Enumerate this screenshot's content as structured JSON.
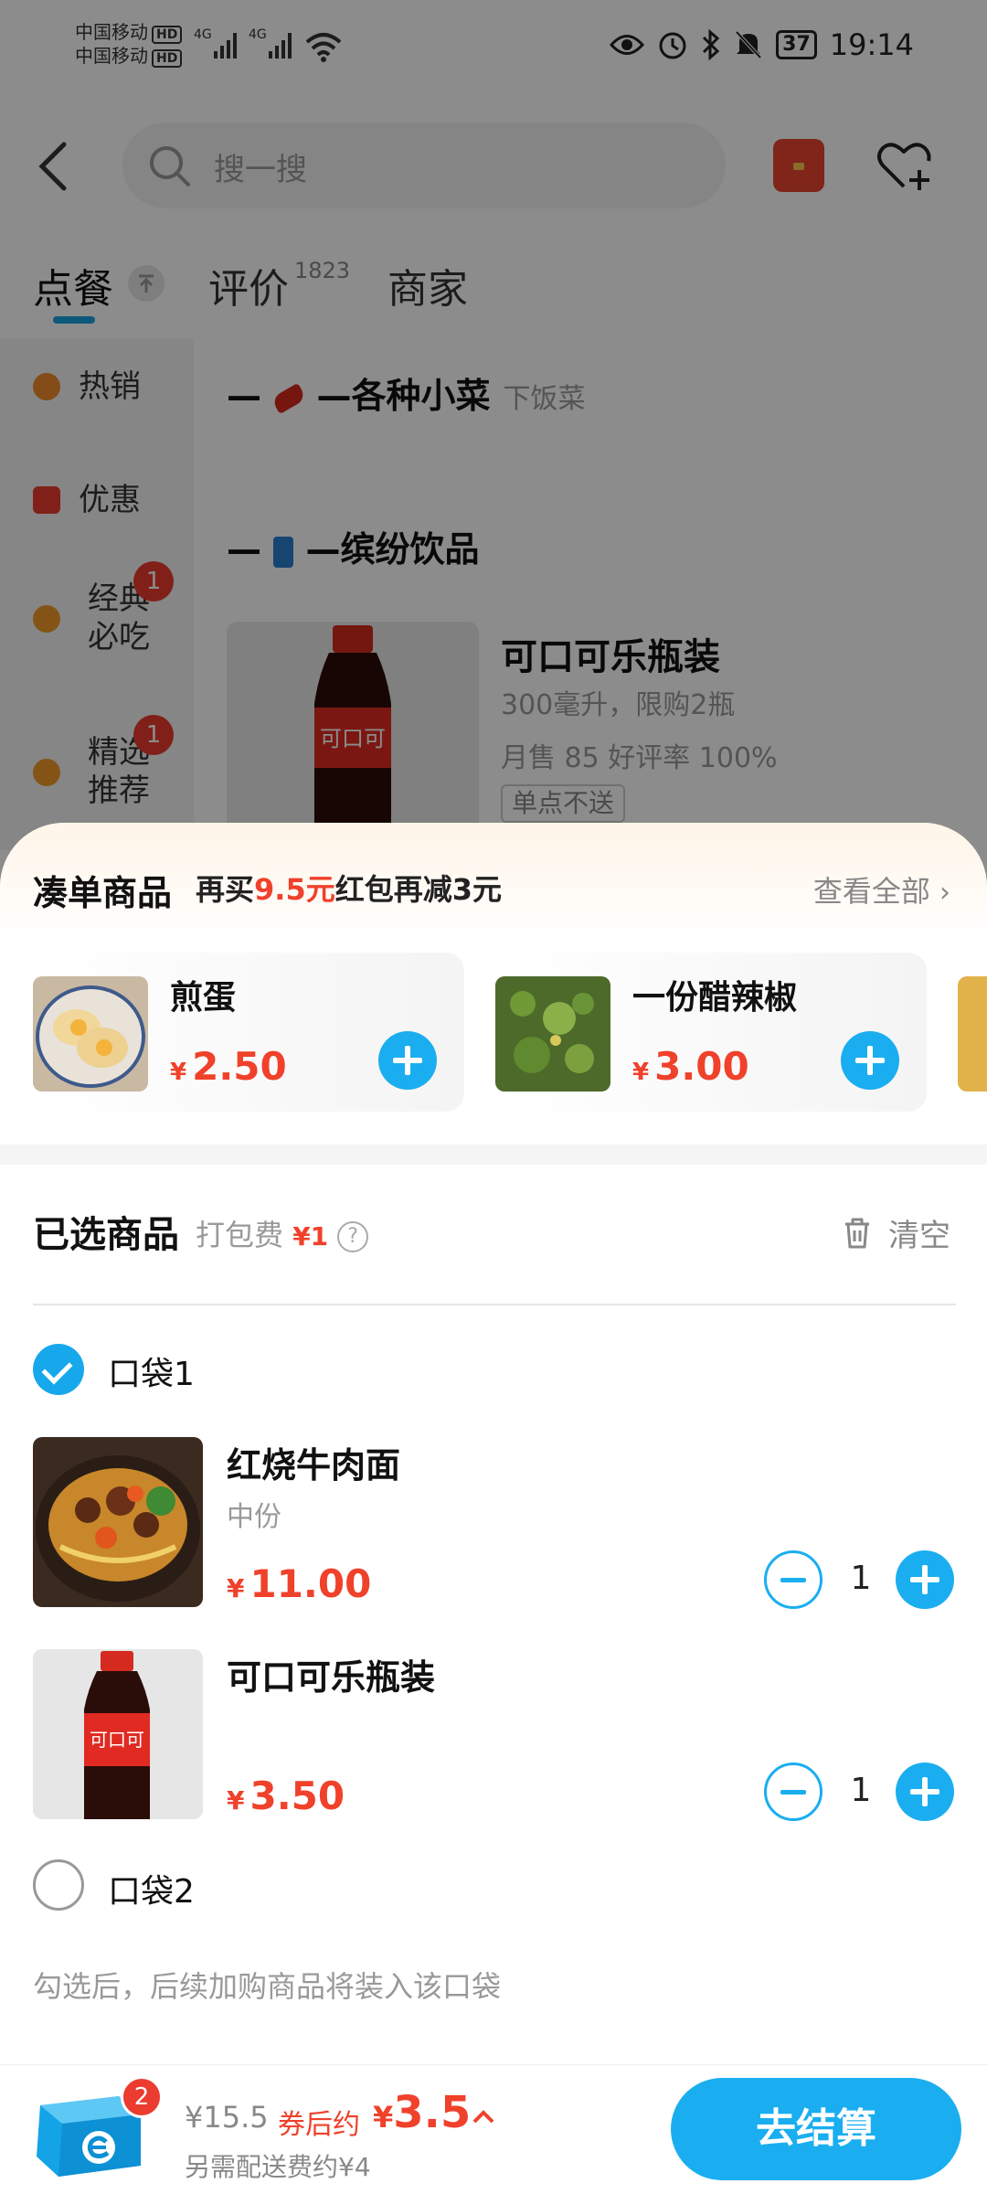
{
  "status_bar": {
    "carrier1": "中国移动",
    "carrier2": "中国移动",
    "hd": "HD",
    "net1": "4G",
    "net2": "4G",
    "battery": "37",
    "time": "19:14"
  },
  "header": {
    "search_placeholder": "搜一搜"
  },
  "tabs": {
    "order": "点餐",
    "reviews": "评价",
    "reviews_count": "1823",
    "merchant": "商家"
  },
  "sidebar": {
    "items": [
      {
        "label": "热销"
      },
      {
        "label": "优惠"
      },
      {
        "label": "经典必吃",
        "line1": "经典",
        "line2": "必吃",
        "badge": "1"
      },
      {
        "label": "精选推荐",
        "line1": "精选",
        "line2": "推荐",
        "badge": "1"
      }
    ]
  },
  "menu": {
    "section1_title": "—各种小菜",
    "section1_sub": "下饭菜",
    "section2_title": "—缤纷饮品",
    "product": {
      "name": "可口可乐瓶装",
      "desc": "300毫升，限购2瓶",
      "stats": "月售 85 好评率 100%",
      "tag": "单点不送"
    }
  },
  "upsell": {
    "title": "凑单商品",
    "note_prefix": "再买",
    "note_amount": "9.5元",
    "note_suffix": "红包再减3元",
    "see_all": "查看全部",
    "items": [
      {
        "name": "煎蛋",
        "currency": "¥",
        "price": "2.50"
      },
      {
        "name": "一份醋辣椒",
        "currency": "¥",
        "price": "3.00"
      }
    ]
  },
  "selected": {
    "title": "已选商品",
    "packing_fee_label": "打包费",
    "packing_fee": "¥1",
    "help_icon_text": "?",
    "clear_label": "清空",
    "bag1": {
      "label": "口袋1",
      "items": [
        {
          "name": "红烧牛肉面",
          "spec": "中份",
          "currency": "¥",
          "price": "11.00",
          "qty": "1"
        },
        {
          "name": "可口可乐瓶装",
          "spec": "",
          "currency": "¥",
          "price": "3.50",
          "qty": "1"
        }
      ]
    },
    "bag2": {
      "label": "口袋2"
    },
    "hint": "勾选后，后续加购商品将装入该口袋"
  },
  "checkout": {
    "cart_count": "2",
    "original_price": "¥15.5",
    "after_coupon_label": "券后约",
    "final_currency": "¥",
    "final_price": "3.5",
    "delivery_note": "另需配送费约¥4",
    "pay_label": "去结算"
  },
  "colors": {
    "accent": "#1aaef0",
    "price_red": "#f0412b",
    "badge_red": "#ec3b2f"
  }
}
